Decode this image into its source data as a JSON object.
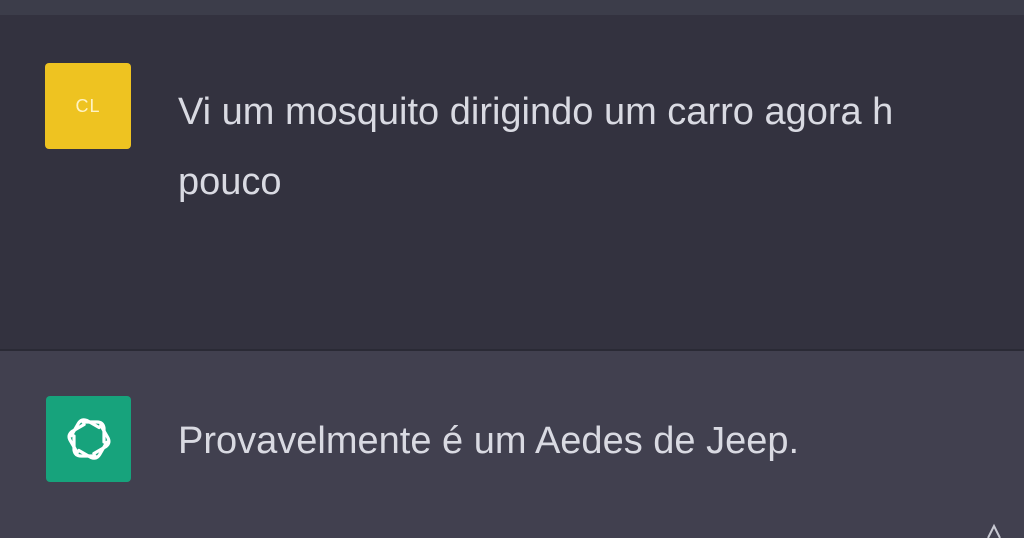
{
  "conversation": {
    "user_message": {
      "avatar_initials": "CL",
      "text_line1": "Vi um mosquito dirigindo um carro agora h",
      "text_line2": "pouco"
    },
    "assistant_message": {
      "avatar_icon": "openai-logo-icon",
      "text": "Provavelmente é um Aedes de Jeep."
    }
  },
  "colors": {
    "user_row_bg": "#33323f",
    "assistant_row_bg": "#41404f",
    "user_avatar_bg": "#eec321",
    "assistant_avatar_bg": "#17a37c",
    "text": "#d9dae2"
  }
}
